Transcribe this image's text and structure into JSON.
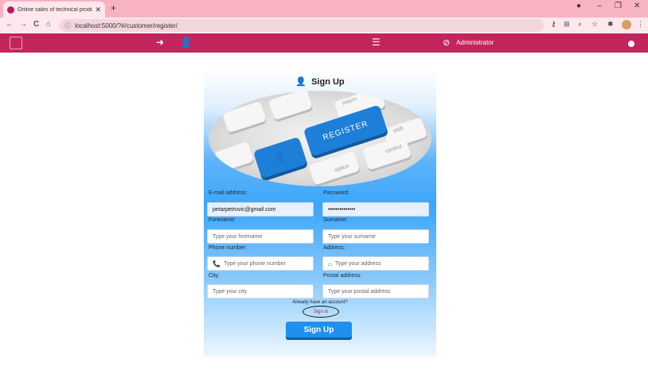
{
  "browser": {
    "tab_title": "Online sales of technical product",
    "tab_close": "✕",
    "new_tab": "+",
    "url": "localhost:5000/?#/customer/register/",
    "back_icon": "←",
    "forward_icon": "→",
    "reload_icon": "C",
    "home_icon": "⌂",
    "info_icon": "ⓘ",
    "minimize": "–",
    "maximize": "❐",
    "close": "✕",
    "key_icon": "⚷",
    "translate_icon": "⊞",
    "zoom_icon": "⌕",
    "star_icon": "☆",
    "extension_icon": "✱",
    "menu_icon": "⋮",
    "record_icon": "●"
  },
  "navbar": {
    "login_icon": "➜",
    "register_icon": "👤",
    "list_icon": "☰",
    "ban_icon": "⊘",
    "role": "Administrator"
  },
  "form": {
    "title": "Sign Up",
    "title_icon": "👤",
    "hero": {
      "register_key": "REGISTER",
      "user_key": "👤",
      "key_labels": [
        "return",
        "control",
        "option",
        "shift"
      ]
    },
    "email_label": "E-mail address:",
    "email_value": "petarpetrovic@gmail.com",
    "password_label": "Password:",
    "password_value": "••••••••••••••",
    "forename_label": "Forename:",
    "forename_placeholder": "Type your forename",
    "surname_label": "Surname:",
    "surname_placeholder": "Type your surname",
    "phone_label": "Phone number:",
    "phone_placeholder": "Type your phone number",
    "phone_icon": "📞",
    "address_label": "Address:",
    "address_placeholder": "Type your address",
    "address_icon": "⌂",
    "city_label": "City:",
    "city_placeholder": "Type your city",
    "postal_label": "Postal address:",
    "postal_placeholder": "Type your postal address",
    "already_text": "Already have an account?",
    "signin_link": "Sign in",
    "submit_label": "Sign Up"
  },
  "colors": {
    "navbar": "#c2255c",
    "accent": "#1e90f0",
    "tabbar": "#f7b3c2"
  }
}
